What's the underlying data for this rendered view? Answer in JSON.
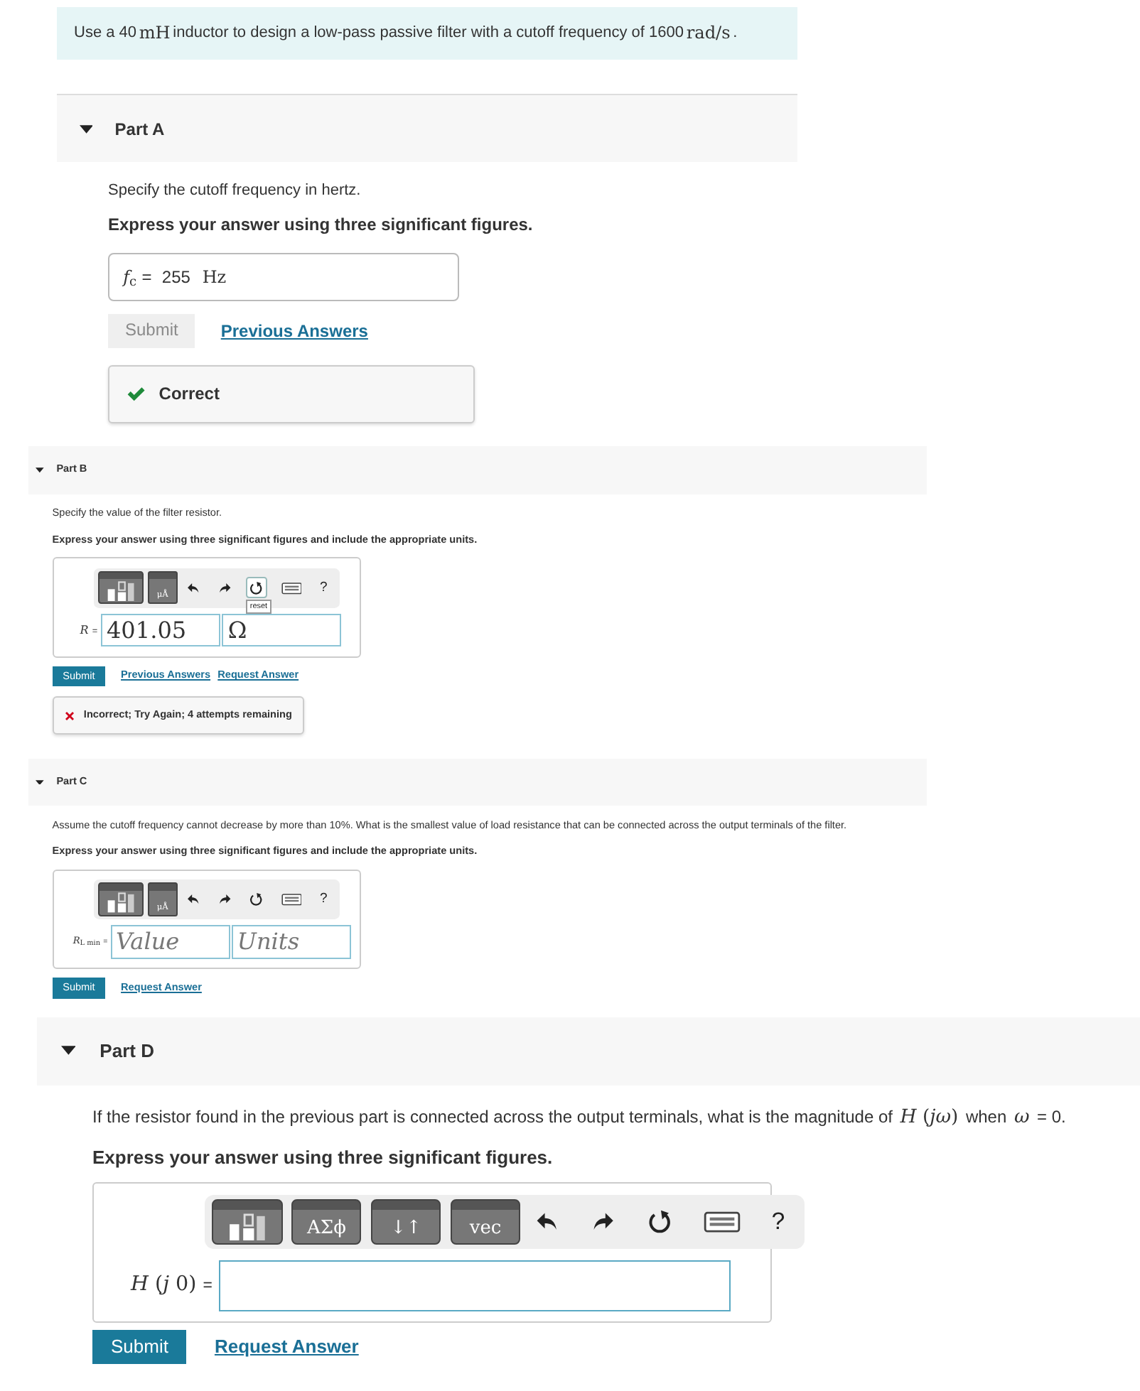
{
  "problem": [
    {
      "text": "Use a 40 ",
      "math": false
    },
    {
      "text": "mH",
      "math": true
    },
    {
      "text": " inductor to design a low-pass passive filter with a cutoff frequency of 1600 ",
      "math": false
    },
    {
      "text": "rad/s",
      "math": true
    },
    {
      "text": " .",
      "math": false
    }
  ],
  "parts": [
    {
      "label": "Part A",
      "expanded": true,
      "prompt": [
        {
          "text": "Specify the cutoff frequency in hertz.",
          "math": false
        }
      ],
      "instruction": "Express your answer using three significant figures.",
      "answer": {
        "kind": "static",
        "symbol": "*f*$_{c}$",
        "equals": "=",
        "value": "255",
        "unit": "Hz"
      },
      "submit": {
        "label": "Submit",
        "disabled": true
      },
      "links": [
        "Previous Answers"
      ],
      "feedback": {
        "kind": "correct",
        "text": "Correct"
      }
    },
    {
      "label": "Part B",
      "expanded": true,
      "prompt": [
        {
          "text": "Specify the value of the filter resistor.",
          "math": false
        }
      ],
      "instruction": "Express your answer using three significant figures and include the appropriate units.",
      "answer": {
        "kind": "editor",
        "toolbar": [
          {
            "kind": "template"
          },
          {
            "kind": "template",
            "label": "μÅ"
          },
          {
            "kind": "undo"
          },
          {
            "kind": "redo"
          },
          {
            "kind": "reset",
            "focused": true,
            "tooltip": "reset"
          },
          {
            "kind": "keyboard"
          },
          {
            "kind": "help",
            "label": "?"
          }
        ],
        "symbol": "*R*",
        "equals": "=",
        "fields": [
          {
            "kind": "value",
            "value": "401.05"
          },
          {
            "kind": "units",
            "value": "Ω"
          }
        ]
      },
      "submit": {
        "label": "Submit",
        "disabled": false
      },
      "links": [
        "Previous Answers",
        "Request Answer"
      ],
      "feedback": {
        "kind": "incorrect",
        "text": "Incorrect; Try Again; 4 attempts remaining"
      }
    },
    {
      "label": "Part C",
      "expanded": true,
      "prompt": [
        {
          "text": "Assume the cutoff frequency cannot decrease by more than 10%. What is the smallest value of load resistance that can be connected across the output terminals of the filter.",
          "math": false
        }
      ],
      "instruction": "Express your answer using three significant figures and include the appropriate units.",
      "answer": {
        "kind": "editor",
        "toolbar": [
          {
            "kind": "template"
          },
          {
            "kind": "template",
            "label": "μÅ"
          },
          {
            "kind": "undo"
          },
          {
            "kind": "redo"
          },
          {
            "kind": "reset",
            "focused": false
          },
          {
            "kind": "keyboard"
          },
          {
            "kind": "help",
            "label": "?"
          }
        ],
        "symbol": "*R*$_{L min}$",
        "equals": "=",
        "fields": [
          {
            "kind": "value",
            "placeholder": "Value"
          },
          {
            "kind": "units",
            "placeholder": "Units"
          }
        ]
      },
      "submit": {
        "label": "Submit",
        "disabled": false
      },
      "links": [
        "Request Answer"
      ]
    },
    {
      "label": "Part D",
      "expanded": true,
      "prompt": [
        {
          "text": "If the resistor found in the previous part is connected across the output terminals, what is the magnitude of ",
          "math": false
        },
        {
          "text": "*H* (*jω*)",
          "math": true
        },
        {
          "text": " when ",
          "math": false
        },
        {
          "text": "*ω*",
          "math": true
        },
        {
          "text": " = 0.",
          "math": false
        }
      ],
      "instruction": "Express your answer using three significant figures.",
      "answer": {
        "kind": "editor",
        "toolbar": [
          {
            "kind": "template"
          },
          {
            "kind": "template",
            "label": "ΑΣϕ"
          },
          {
            "kind": "template",
            "label": "↓↑"
          },
          {
            "kind": "template",
            "label": "vec"
          },
          {
            "kind": "undo"
          },
          {
            "kind": "redo"
          },
          {
            "kind": "reset",
            "focused": false
          },
          {
            "kind": "keyboard"
          },
          {
            "kind": "help",
            "label": "?"
          }
        ],
        "symbol": "*H* (*j* 0)",
        "equals": "=",
        "fields": [
          {
            "kind": "wide"
          }
        ]
      },
      "submit": {
        "label": "Submit",
        "disabled": false
      },
      "links": [
        "Request Answer"
      ]
    }
  ]
}
